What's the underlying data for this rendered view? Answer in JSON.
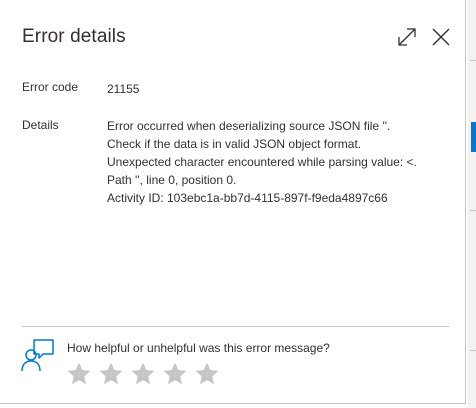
{
  "dialog": {
    "title": "Error details",
    "expand_icon": "expand-icon",
    "close_icon": "close-icon"
  },
  "fields": {
    "error_code_label": "Error code",
    "error_code_value": "21155",
    "details_label": "Details",
    "details_lines": [
      "Error occurred when deserializing source JSON file ''.",
      "Check if the data is in valid JSON object format.",
      "Unexpected character encountered while parsing value: <.",
      "Path '', line 0, position 0.",
      "Activity ID: 103ebc1a-bb7d-4115-897f-f9eda4897c66"
    ]
  },
  "feedback": {
    "icon": "feedback-person-chat-icon",
    "question": "How helpful or unhelpful was this error message?",
    "star_count": 5,
    "rating": 0
  },
  "colors": {
    "text": "#323130",
    "divider": "#c8c6c4",
    "accent": "#0078d4",
    "star_empty": "#c8c6c4"
  }
}
